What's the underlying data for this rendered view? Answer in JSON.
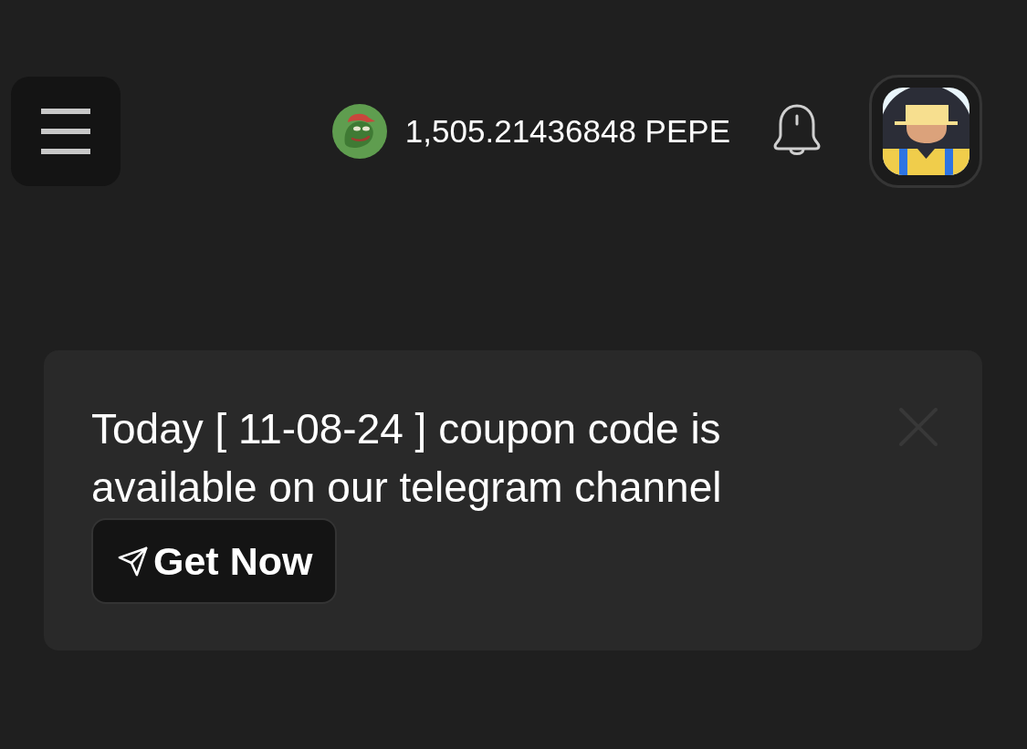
{
  "header": {
    "balance": "1,505.21436848 PEPE"
  },
  "notice": {
    "message": "Today [ 11-08-24 ] coupon code is available on our telegram channel",
    "button": "Get Now"
  }
}
